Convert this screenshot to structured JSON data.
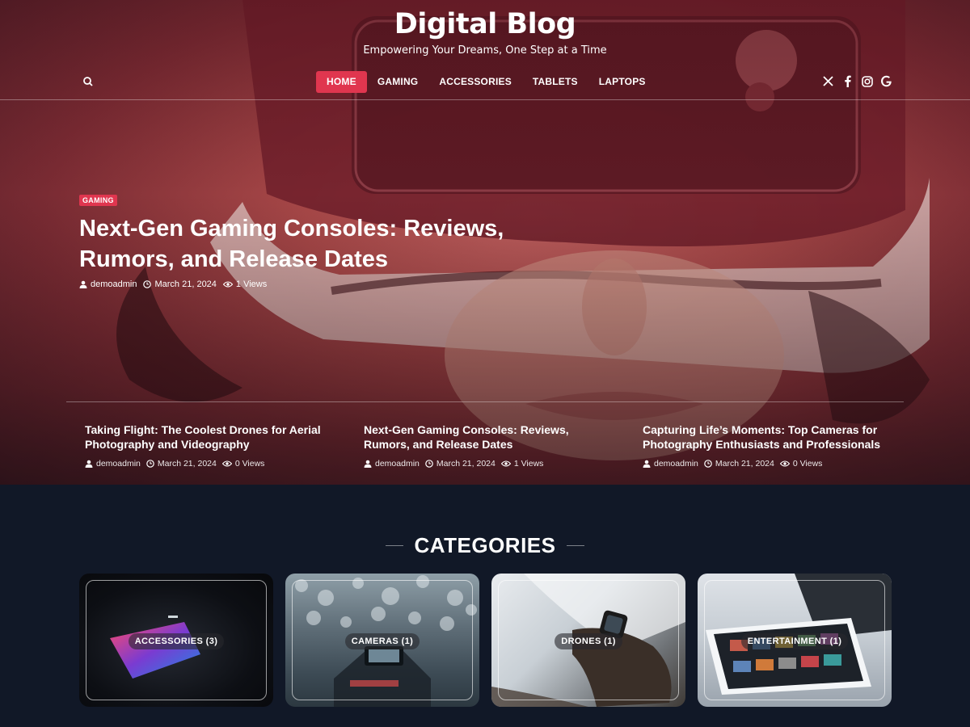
{
  "site": {
    "title": "Digital Blog",
    "tagline": "Empowering Your Dreams, One Step at a Time"
  },
  "nav": {
    "items": [
      {
        "label": "HOME",
        "active": true
      },
      {
        "label": "GAMING",
        "active": false
      },
      {
        "label": "ACCESSORIES",
        "active": false
      },
      {
        "label": "TABLETS",
        "active": false
      },
      {
        "label": "LAPTOPS",
        "active": false
      }
    ],
    "search_icon": "search-icon",
    "social": [
      "x-icon",
      "facebook-icon",
      "instagram-icon",
      "google-icon"
    ]
  },
  "featured": {
    "category": "GAMING",
    "title": "Next-Gen Gaming Consoles: Reviews, Rumors, and Release Dates",
    "author": "demoadmin",
    "date": "March 21, 2024",
    "views": "1 Views"
  },
  "hero_posts": [
    {
      "title": "Taking Flight: The Coolest Drones for Aerial Photography and Videography",
      "author": "demoadmin",
      "date": "March 21, 2024",
      "views": "0 Views"
    },
    {
      "title": "Next-Gen Gaming Consoles: Reviews, Rumors, and Release Dates",
      "author": "demoadmin",
      "date": "March 21, 2024",
      "views": "1 Views"
    },
    {
      "title": "Capturing Life’s Moments: Top Cameras for Photography Enthusiasts and Professionals",
      "author": "demoadmin",
      "date": "March 21, 2024",
      "views": "0 Views"
    }
  ],
  "categories": {
    "heading": "CATEGORIES",
    "items": [
      {
        "label": "ACCESSORIES (3)"
      },
      {
        "label": "CAMERAS (1)"
      },
      {
        "label": "DRONES (1)"
      },
      {
        "label": "ENTERTAINMENT (1)"
      }
    ]
  },
  "colors": {
    "accent": "#e0364f",
    "page_bg": "#111827",
    "hero_tint": "#a84848"
  }
}
